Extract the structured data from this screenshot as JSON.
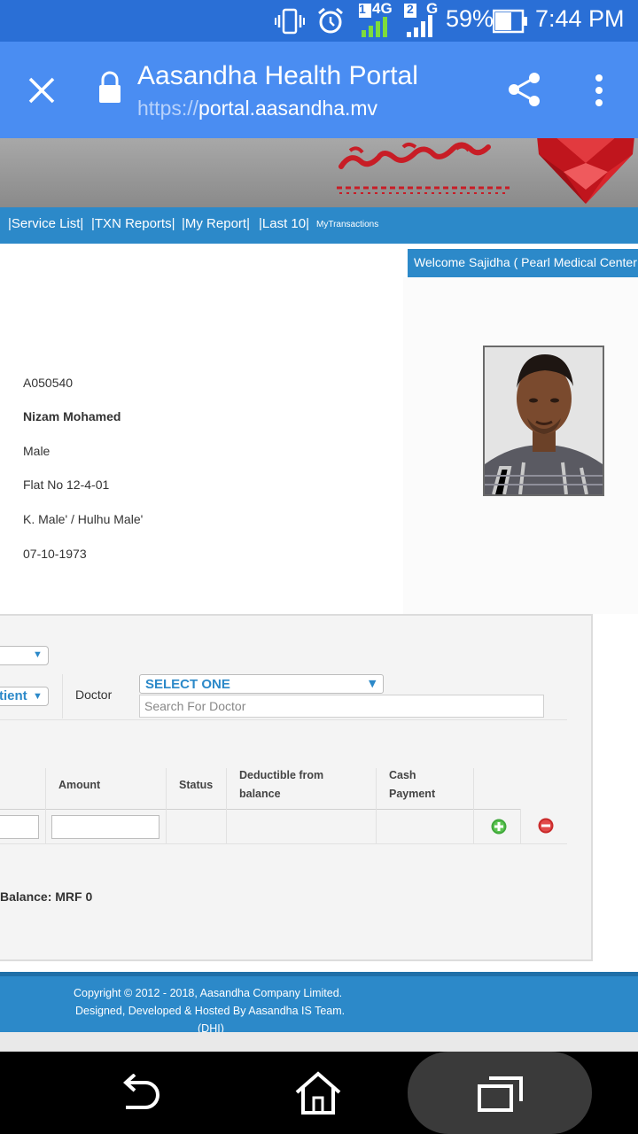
{
  "status_bar": {
    "network_1": "4G",
    "sim1": "1",
    "sim2": "2",
    "network_2": "G",
    "battery": "59%",
    "time": "7:44 PM",
    "icons": [
      "vibrate-icon",
      "alarm-icon",
      "signal-icon",
      "battery-icon"
    ]
  },
  "browser": {
    "title": "Aasandha Health Portal",
    "url_scheme": "https://",
    "url_host": "portal.aasandha.mv",
    "icons": [
      "close-icon",
      "lock-icon",
      "share-icon",
      "more-vert-icon"
    ]
  },
  "nav": {
    "items": [
      "|Service List|",
      "|TXN Reports|",
      "|My Report|",
      "|Last 10|",
      "MyTransactions"
    ]
  },
  "welcome": "Welcome Sajidha ( Pearl Medical Center",
  "patient": {
    "id": "A050540",
    "name": "Nizam Mohamed",
    "gender": "Male",
    "address": "Flat No 12-4-01",
    "island": "K. Male' / Hulhu Male'",
    "dob": "07-10-1973"
  },
  "form": {
    "patient_type_partial": "tient",
    "doctor_label": "Doctor",
    "doctor_select": "SELECT ONE",
    "doctor_search_placeholder": "Search For Doctor",
    "columns": {
      "amount": "Amount",
      "status": "Status",
      "deductible_1": "Deductible from",
      "deductible_2": "balance",
      "cash_1": "Cash",
      "cash_2": "Payment"
    },
    "balance": "Balance: MRF 0"
  },
  "footer": {
    "line1": "Copyright © 2012 - 2018, Aasandha Company Limited.",
    "line2": "Designed, Developed & Hosted By Aasandha IS Team.",
    "line3": "(DHI)"
  },
  "android_nav": [
    "back-icon",
    "home-icon",
    "recents-icon"
  ],
  "colors": {
    "status_bar": "#2a6fd6",
    "toolbar": "#4a8df2",
    "portal_blue": "#2c89c9",
    "accent_text": "#2c89c9"
  }
}
